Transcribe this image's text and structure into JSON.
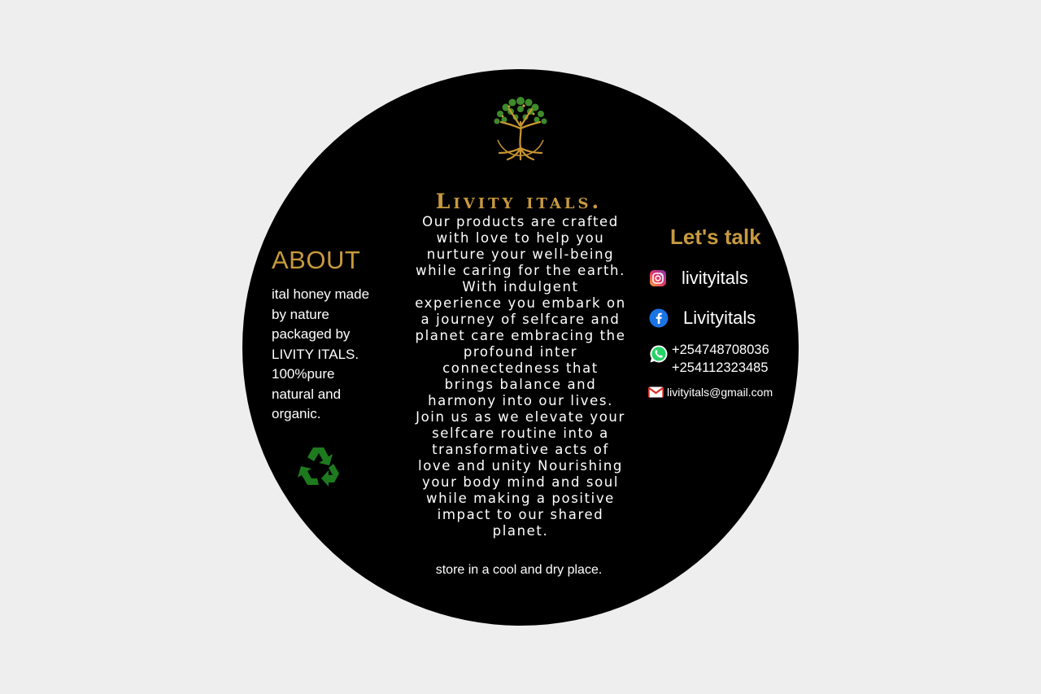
{
  "brand": "Livity itals.",
  "description_lines": [
    "Our products are crafted",
    "with love to  help you",
    "nurture your well-being",
    "while caring for the earth.",
    "With indulgent",
    "experience you embark on",
    "a journey of selfcare and",
    "planet care embracing the",
    "profound inter",
    "connectedness that",
    "brings balance and",
    "harmony into our lives.",
    "Join us as we elevate your",
    "selfcare routine into a",
    "transformative acts of",
    "love and unity Nourishing",
    "your body mind and soul",
    "while making a positive",
    "impact to our shared",
    "planet."
  ],
  "storage_note": "store in a cool and dry place.",
  "about": {
    "title": "ABOUT",
    "lines": [
      "ital honey made",
      "by nature",
      "packaged by",
      "LIVITY ITALS.",
      "100%pure",
      "natural and",
      "organic."
    ]
  },
  "contact": {
    "title": "Let's talk",
    "instagram": "livityitals",
    "facebook": "Livityitals",
    "phones": [
      "+254748708036",
      "+254112323485"
    ],
    "email": "livityitals@gmail.com"
  },
  "colors": {
    "background": "#eeeeee",
    "label": "#000000",
    "accent_gold": "#c89a3e",
    "text": "#ffffff",
    "recycle_green": "#1e7a1e"
  },
  "icons": [
    "tree-of-life-logo",
    "recycle-icon",
    "instagram-icon",
    "facebook-icon",
    "whatsapp-icon",
    "gmail-icon"
  ]
}
